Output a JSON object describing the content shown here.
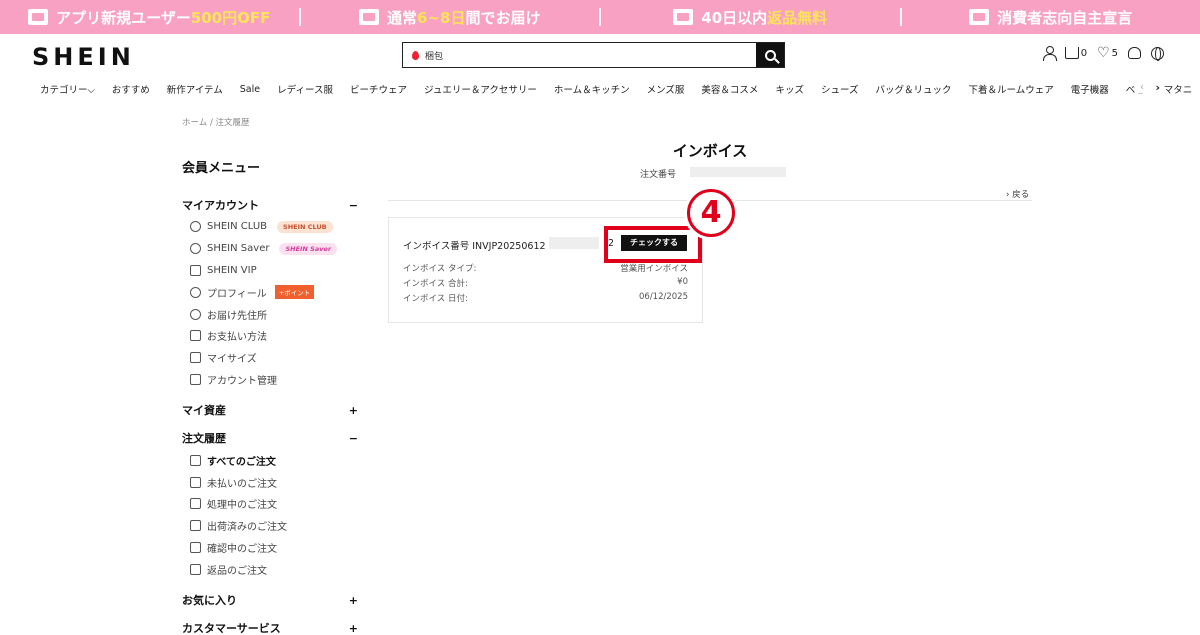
{
  "promo": {
    "items": [
      {
        "pre": "アプリ新規ユーザー",
        "hl": "500円OFF",
        "post": "",
        "icon": "app-icon"
      },
      {
        "pre": "通常",
        "hl": "6~8日",
        "post": "間でお届け",
        "icon": "truck-icon"
      },
      {
        "pre": "40日以内",
        "hl": "返品無料",
        "post": "",
        "icon": "return-box-icon"
      },
      {
        "pre": "消費者志向自主宣言",
        "hl": "",
        "post": "",
        "icon": "people-icon"
      }
    ]
  },
  "header": {
    "logo": "SHEIN",
    "search_value": "梱包",
    "cart_count": "0",
    "wishlist_count": "5"
  },
  "categories": [
    "カテゴリー⌵",
    "おすすめ",
    "新作アイテム",
    "Sale",
    "レディース服",
    "ビーチウェア",
    "ジュエリー＆アクセサリー",
    "ホーム＆キッチン",
    "メンズ服",
    "美容＆コスメ",
    "キッズ",
    "シューズ",
    "バッグ＆リュック",
    "下着＆ルームウェア",
    "電子機器",
    "ベビー＆マタニ"
  ],
  "nav_arrows": {
    "left": "‹",
    "right": "›"
  },
  "breadcrumb": "ホーム / 注文履歴",
  "sidebar": {
    "title": "会員メニュー",
    "my_account": {
      "label": "マイアカウント",
      "toggle": "−",
      "items": [
        {
          "label": "SHEIN CLUB",
          "badge": "SHEIN CLUB"
        },
        {
          "label": "SHEIN Saver",
          "badge": "SHEIN Saver"
        },
        {
          "label": "SHEIN VIP"
        },
        {
          "label": "プロフィール",
          "badge": "+ポイント"
        },
        {
          "label": "お届け先住所"
        },
        {
          "label": "お支払い方法"
        },
        {
          "label": "マイサイズ"
        },
        {
          "label": "アカウント管理"
        }
      ]
    },
    "my_assets": {
      "label": "マイ資産",
      "toggle": "+"
    },
    "orders": {
      "label": "注文履歴",
      "toggle": "−",
      "items": [
        {
          "label": "すべてのご注文"
        },
        {
          "label": "未払いのご注文"
        },
        {
          "label": "処理中のご注文"
        },
        {
          "label": "出荷済みのご注文"
        },
        {
          "label": "確認中のご注文"
        },
        {
          "label": "返品のご注文"
        }
      ]
    },
    "favorites": {
      "label": "お気に入り",
      "toggle": "+"
    },
    "customer_service": {
      "label": "カスタマーサービス",
      "toggle": "+"
    }
  },
  "main": {
    "title": "インボイス",
    "order_no_label": "注文番号",
    "back": "› 戻る",
    "invoice": {
      "number_label": "インボイス番号 INVJP20250612",
      "number_tail": "2",
      "check_button": "チェックする",
      "rows": [
        {
          "label": "インボイス タイプ:",
          "value": "営業用インボイス"
        },
        {
          "label": "インボイス 合計:",
          "value": "¥0"
        },
        {
          "label": "インボイス 日付:",
          "value": "06/12/2025"
        }
      ]
    },
    "step_marker": "4"
  }
}
